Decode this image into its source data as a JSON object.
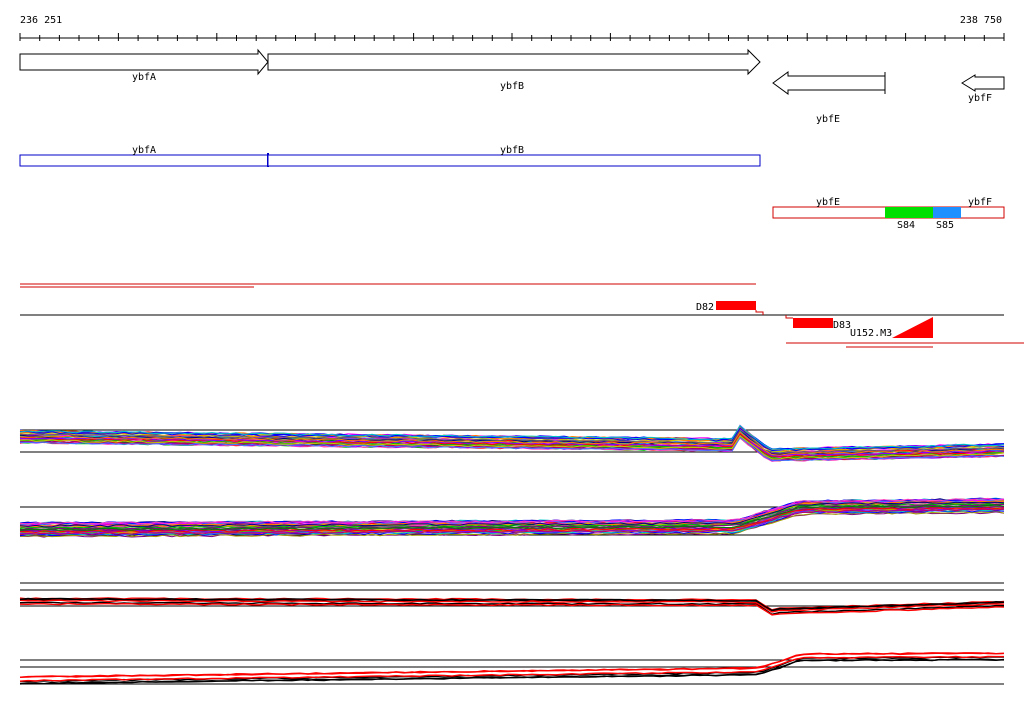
{
  "ruler": {
    "start_label": "236 251",
    "end_label": "238 750"
  },
  "genes": [
    {
      "name": "ybfA",
      "strand": "+"
    },
    {
      "name": "ybfB",
      "strand": "+"
    },
    {
      "name": "ybfE",
      "strand": "-"
    },
    {
      "name": "ybfF",
      "strand": "-"
    }
  ],
  "blue_track": [
    {
      "name": "ybfA"
    },
    {
      "name": "ybfB"
    }
  ],
  "red_track": {
    "gene_labels": [
      "ybfE",
      "ybfF"
    ],
    "segments": [
      {
        "name": "S84",
        "color": "#00e000"
      },
      {
        "name": "S85",
        "color": "#1e90ff"
      }
    ]
  },
  "features": [
    {
      "name": "D82"
    },
    {
      "name": "D83"
    },
    {
      "name": "U152.M3"
    }
  ],
  "colors": {
    "gene_outline": "#000000",
    "blue_track": "#0000c8",
    "red_track": "#d00000",
    "feature_red": "#ff0000"
  }
}
